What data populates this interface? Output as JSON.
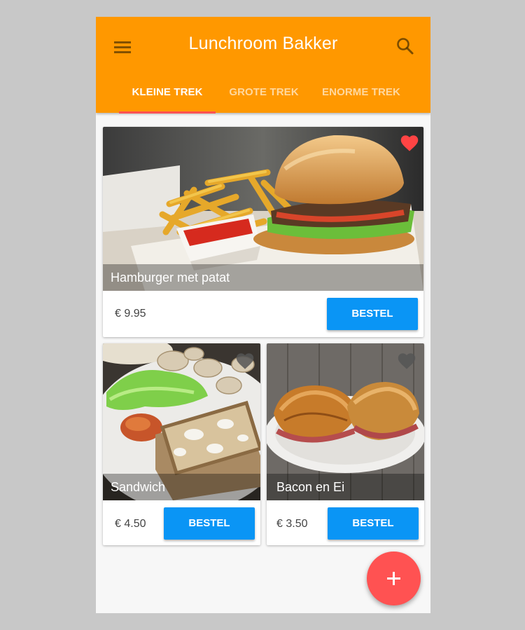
{
  "app": {
    "title": "Lunchroom Bakker",
    "accent_color": "#ff9800",
    "indicator_color": "#ff5252",
    "button_color": "#0a95f5"
  },
  "toolbar": {
    "menu_icon": "hamburger-menu-icon",
    "search_icon": "search-icon"
  },
  "tabs": [
    {
      "label": "KLEINE TREK",
      "selected": true
    },
    {
      "label": "GROTE TREK",
      "selected": false
    },
    {
      "label": "ENORME TREK",
      "selected": false
    }
  ],
  "products": [
    {
      "name": "Hamburger met patat",
      "price": "€ 9.95",
      "button": "BESTEL",
      "favorite": true,
      "image": "hamburger-with-fries"
    },
    {
      "name": "Sandwich",
      "price": "€ 4.50",
      "button": "BESTEL",
      "favorite": false,
      "image": "sandwich-salad"
    },
    {
      "name": "Bacon en Ei",
      "price": "€ 3.50",
      "button": "BESTEL",
      "favorite": false,
      "image": "bacon-egg-croissant"
    }
  ],
  "fab": {
    "icon": "plus-icon"
  }
}
